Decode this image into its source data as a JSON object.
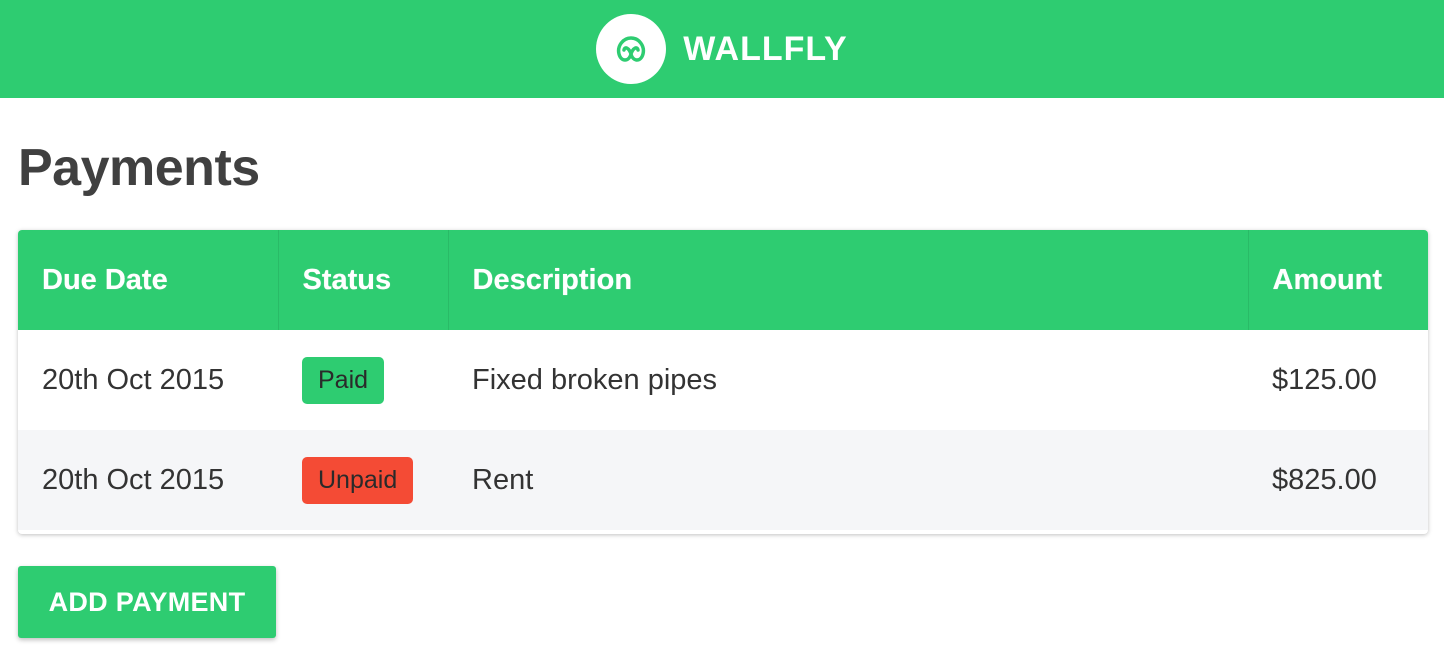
{
  "header": {
    "brand_name": "WALLFLY",
    "logo_icon": "wallfly-logo-icon",
    "background_color": "#2ecc71"
  },
  "page": {
    "title": "Payments"
  },
  "table": {
    "columns": [
      "Due Date",
      "Status",
      "Description",
      "Amount"
    ],
    "rows": [
      {
        "due_date": "20th Oct 2015",
        "status": "Paid",
        "status_color": "#2ecc71",
        "description": "Fixed broken pipes",
        "amount": "$125.00"
      },
      {
        "due_date": "20th Oct 2015",
        "status": "Unpaid",
        "status_color": "#f44b35",
        "description": "Rent",
        "amount": "$825.00"
      }
    ]
  },
  "actions": {
    "add_payment_label": "ADD PAYMENT"
  }
}
